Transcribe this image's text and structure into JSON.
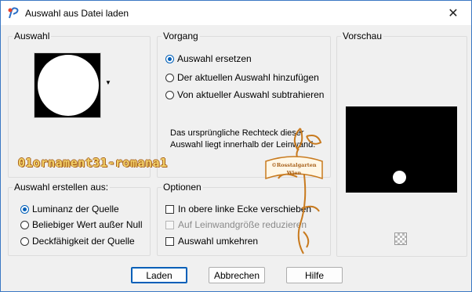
{
  "window": {
    "title": "Auswahl aus Datei laden"
  },
  "groups": {
    "auswahl": {
      "title": "Auswahl"
    },
    "vorgang": {
      "title": "Vorgang",
      "options": [
        {
          "label": "Auswahl ersetzen",
          "checked": true
        },
        {
          "label": "Der aktuellen Auswahl hinzufügen",
          "checked": false
        },
        {
          "label": "Von aktueller Auswahl subtrahieren",
          "checked": false
        }
      ],
      "info": "Das ursprüngliche Rechteck dieser Auswahl liegt innerhalb der Leinwand."
    },
    "vorschau": {
      "title": "Vorschau"
    },
    "erstellen": {
      "title": "Auswahl erstellen aus:",
      "options": [
        {
          "label": "Luminanz der Quelle",
          "checked": true
        },
        {
          "label": "Beliebiger Wert außer Null",
          "checked": false
        },
        {
          "label": "Deckfähigkeit der Quelle",
          "checked": false
        }
      ]
    },
    "optionen": {
      "title": "Optionen",
      "checks": [
        {
          "label": "In obere linke Ecke verschieben",
          "checked": false,
          "disabled": false
        },
        {
          "label": "Auf Leinwandgröße reduzieren",
          "checked": false,
          "disabled": true
        },
        {
          "label": "Auswahl umkehren",
          "checked": false,
          "disabled": false
        }
      ]
    }
  },
  "overlay": {
    "filename": "01ornament31-romana1",
    "stamp_line1": "©Rosstalgarten",
    "stamp_line2": "Wien"
  },
  "buttons": {
    "load": "Laden",
    "cancel": "Abbrechen",
    "help": "Hilfe"
  },
  "colors": {
    "accent": "#005fb8",
    "watermark": "#c87a1e"
  }
}
